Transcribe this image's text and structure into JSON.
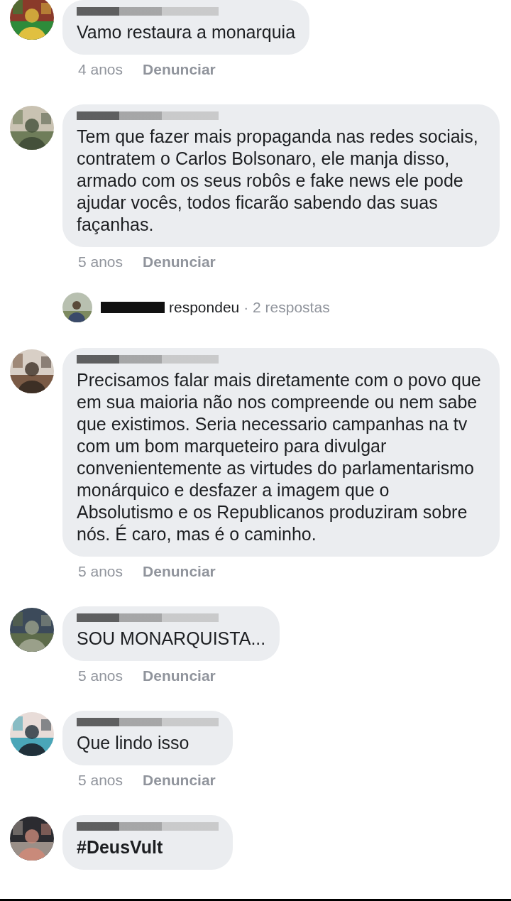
{
  "comments": [
    {
      "text": "Vamo restaura a monarquia",
      "bold": false,
      "time": "4 anos",
      "report": "Denunciar"
    },
    {
      "text": "Tem que fazer mais propaganda nas redes sociais, contratem o Carlos Bolsonaro, ele manja disso, armado com os seus robôs e fake news ele pode ajudar vocês, todos ficarão sabendo das suas façanhas.",
      "bold": false,
      "time": "5 anos",
      "report": "Denunciar",
      "reply_summary": {
        "verb": "respondeu",
        "count": "· 2 respostas"
      }
    },
    {
      "text": "Precisamos falar mais diretamente com o povo que em sua maioria não nos compreende ou nem sabe que existimos. Seria necessario campanhas na tv com um bom marqueteiro para divulgar convenientemente as virtudes do parlamentarismo monárquico e desfazer a imagem que o Absolutismo e os Republicanos produziram sobre nós. É caro, mas é o caminho.",
      "bold": false,
      "time": "5 anos",
      "report": "Denunciar"
    },
    {
      "text": "SOU MONARQUISTA...",
      "bold": false,
      "time": "5 anos",
      "report": "Denunciar"
    },
    {
      "text": "Que lindo isso",
      "bold": false,
      "time": "5 anos",
      "report": "Denunciar"
    },
    {
      "text": "#DeusVult",
      "bold": true
    }
  ]
}
